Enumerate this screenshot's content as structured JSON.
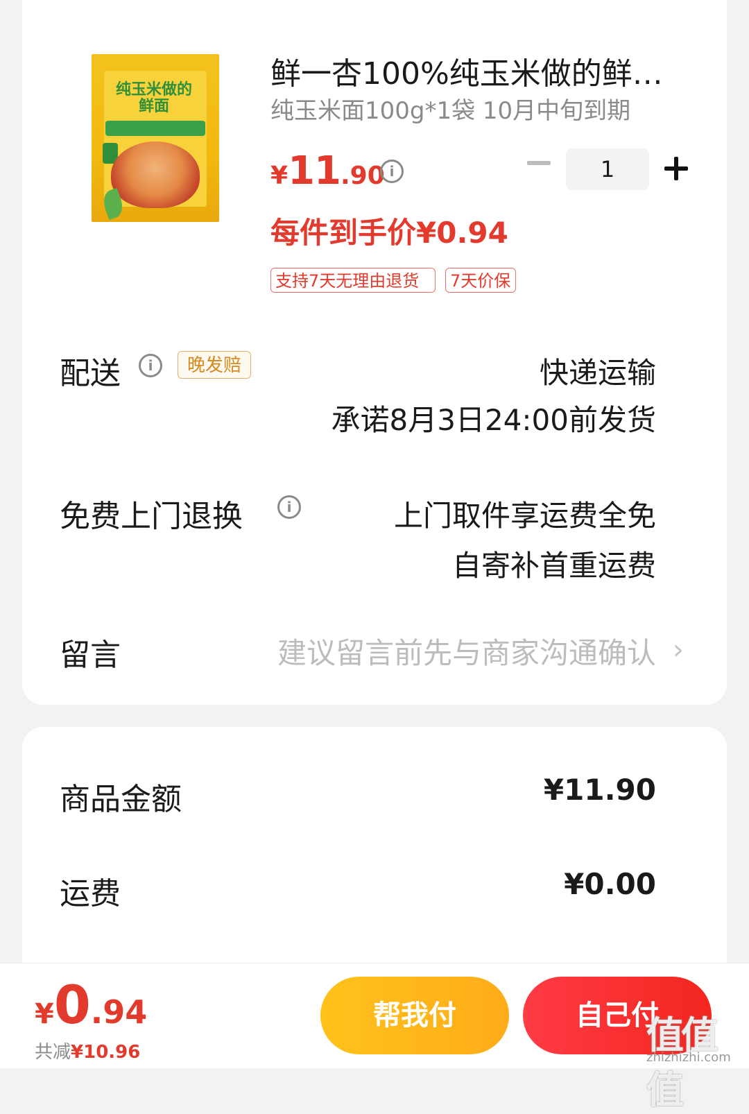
{
  "product": {
    "title": "鲜一杏100%纯玉米做的鲜…",
    "spec": "纯玉米面100g*1袋 10月中旬到期",
    "price_symbol": "¥",
    "price_int": "11",
    "price_dec": ".90",
    "quantity": "1",
    "each_price": "每件到手价¥0.94",
    "tags": [
      "支持7天无理由退货",
      "7天价保"
    ],
    "image_text": "纯玉米做的鲜面"
  },
  "delivery": {
    "label": "配送",
    "late_tag": "晚发赔",
    "method": "快递运输",
    "promise": "承诺8月3日24:00前发货"
  },
  "return_service": {
    "label": "免费上门退换",
    "line1": "上门取件享运费全免",
    "line2": "自寄补首重运费"
  },
  "message": {
    "label": "留言",
    "placeholder": "建议留言前先与商家沟通确认"
  },
  "summary": {
    "goods_label": "商品金额",
    "goods_value": "¥11.90",
    "shipping_label": "运费",
    "shipping_value": "¥0.00"
  },
  "footer": {
    "total_symbol": "¥",
    "total_int": "0",
    "total_dec": ".94",
    "saved_prefix": "共减",
    "saved_value": "¥10.96",
    "help_pay": "帮我付",
    "self_pay": "自己付"
  },
  "watermark": {
    "chars": "值值值",
    "url": "zhizhizhi.com"
  },
  "colors": {
    "accent_red": "#e23a2c",
    "help_button": "#ffb71a",
    "self_button": "#f3261f"
  }
}
